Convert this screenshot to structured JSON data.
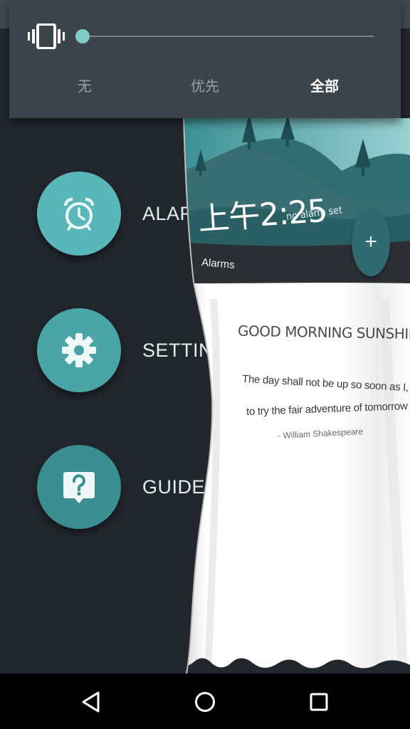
{
  "volume_panel": {
    "icon": "vibrate-icon",
    "slider_level_percent": 0,
    "dnd_tabs": [
      {
        "label": "无",
        "active": false
      },
      {
        "label": "优先",
        "active": false
      },
      {
        "label": "全部",
        "active": true
      }
    ]
  },
  "menu": {
    "items": [
      {
        "label": "ALARMS",
        "icon": "alarm-clock-icon",
        "color": "#5ab7b9"
      },
      {
        "label": "SETTINGS",
        "icon": "gear-icon",
        "color": "#4aa5a7"
      },
      {
        "label": "GUIDE",
        "icon": "help-icon",
        "color": "#3b8e90"
      }
    ]
  },
  "curtain": {
    "time": "上午2:25",
    "no_alarm": "no alarm set",
    "alarms_label": "Alarms",
    "add_button": "+",
    "quote_title": "GOOD MORNING SUNSHINE",
    "quote_line1": "The day shall not be up so soon  as I,",
    "quote_line2": "to try the fair adventure of tomorrow",
    "quote_author": "- William Shakespeare"
  },
  "navbar": {
    "buttons": [
      "back-icon",
      "home-icon",
      "recents-icon"
    ]
  },
  "colors": {
    "background": "#22272d",
    "panel": "#3b444b",
    "accent": "#80cbc4",
    "teal_dark": "#2e6a6f"
  }
}
